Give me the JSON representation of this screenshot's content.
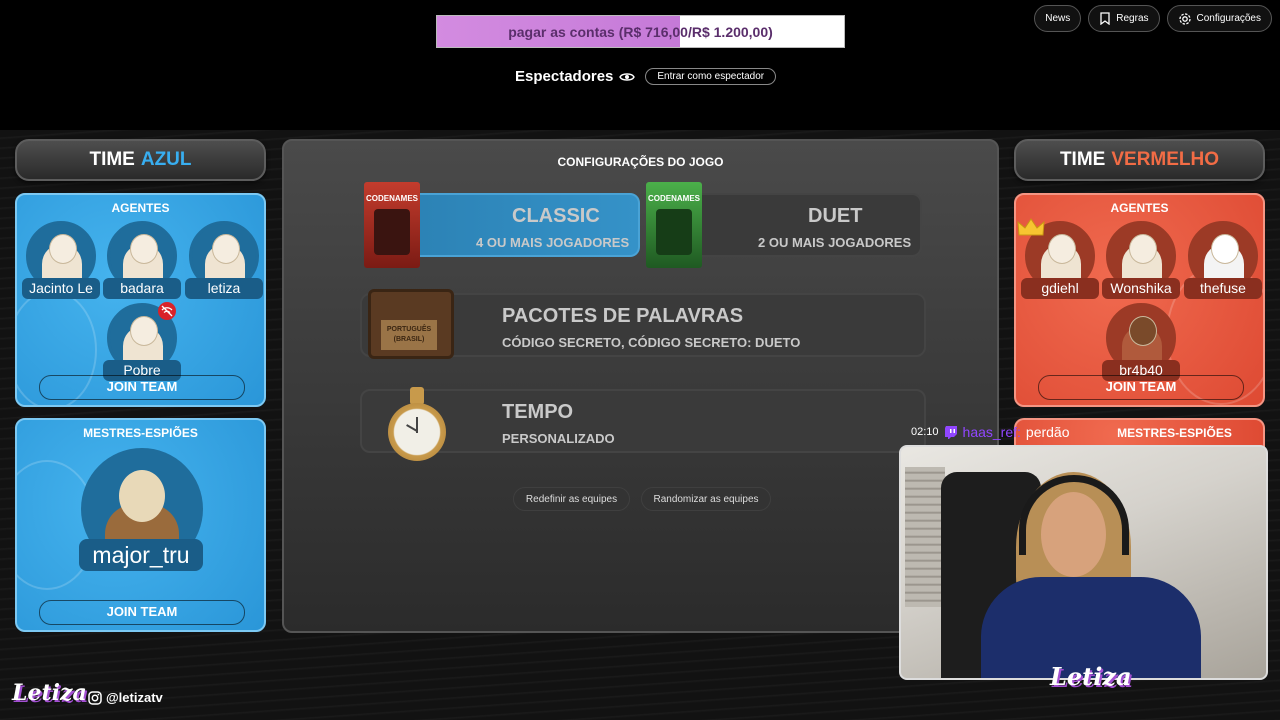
{
  "goal": {
    "text": "pagar as contas (R$ 716,00/R$ 1.200,00)",
    "progress": 0.5967
  },
  "top_buttons": {
    "news": "News",
    "rules": "Regras",
    "settings": "Configurações"
  },
  "spectators": {
    "label": "Espectadores",
    "button": "Entrar como espectador"
  },
  "blue_team": {
    "title_prefix": "TIME",
    "title_color": "AZUL",
    "agents_title": "AGENTES",
    "agents": [
      "Jacinto Le",
      "badara",
      "letiza",
      "Pobre"
    ],
    "join_agents": "JOIN TEAM",
    "spymasters_title": "MESTRES-ESPIÕES",
    "spymaster": "major_tru",
    "join_spymasters": "JOIN TEAM"
  },
  "red_team": {
    "title_prefix": "TIME",
    "title_color": "VERMELHO",
    "agents_title": "AGENTES",
    "agents": [
      "gdiehl",
      "Wonshika",
      "thefuse",
      "br4b40"
    ],
    "join_agents": "JOIN TEAM",
    "spymasters_title": "MESTRES-ESPIÕES"
  },
  "config": {
    "title": "CONFIGURAÇÕES DO JOGO",
    "classic": {
      "name": "CLASSIC",
      "sub": "4 OU MAIS JOGADORES",
      "box_label": "CODENAMES"
    },
    "duet": {
      "name": "DUET",
      "sub": "2 OU MAIS JOGADORES",
      "box_label": "CODENAMES"
    },
    "packs": {
      "title": "PACOTES DE PALAVRAS",
      "sub": "CÓDIGO SECRETO, CÓDIGO SECRETO: DUETO",
      "sign_line1": "PORTUGUÊS",
      "sign_line2": "(BRASIL)"
    },
    "time": {
      "title": "TEMPO",
      "sub": "PERSONALIZADO"
    },
    "reset_button": "Redefinir as equipes",
    "randomize_button": "Randomizar as equipes"
  },
  "chat": {
    "time": "02:10",
    "user": "haas_ref:",
    "message": "perdão"
  },
  "branding": {
    "logo": "Letiza",
    "cam_logo": "Letiza",
    "instagram": "@letizatv"
  },
  "colors": {
    "blue": "#2a96d8",
    "red": "#de4a33",
    "blue_text": "#38aef0",
    "red_text": "#f26c45",
    "twitch": "#9146ff"
  }
}
